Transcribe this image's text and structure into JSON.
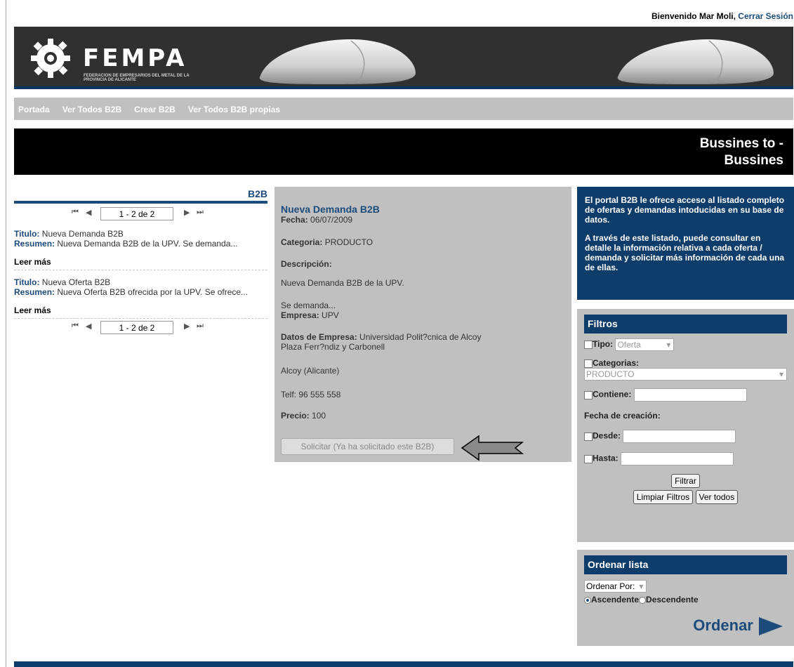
{
  "header": {
    "welcome": "Bienvenido Mar Moli,",
    "logout": "Cerrar Sesión"
  },
  "logo": {
    "name": "FEMPA",
    "subtitle": "FEDERACION DE EMPRESARIOS DEL METAL DE LA PROVINCIA DE ALICANTE"
  },
  "nav": {
    "items": [
      "Portada",
      "Ver Todos B2B",
      "Crear B2B",
      "Ver Todos B2B propias"
    ]
  },
  "page_title": {
    "line1": "Bussines to -",
    "line2": "Bussines"
  },
  "list": {
    "heading": "B2B",
    "pager_text": "1 - 2 de 2",
    "title_label": "Titulo:",
    "summary_label": "Resumen:",
    "items": [
      {
        "title": "Nueva Demanda B2B",
        "summary": "Nueva Demanda B2B de la UPV. Se demanda...",
        "more": "Leer más"
      },
      {
        "title": "Nueva Oferta B2B",
        "summary": "Nueva Oferta B2B ofrecida por la UPV. Se ofrece...",
        "more": "Leer más"
      }
    ]
  },
  "detail": {
    "title": "Nueva Demanda B2B",
    "fecha_label": "Fecha:",
    "fecha": "06/07/2009",
    "categoria_label": "Categoria:",
    "categoria": "PRODUCTO",
    "descripcion_label": "Descripción:",
    "descripcion1": "Nueva Demanda B2B de la UPV.",
    "descripcion2": "Se demanda...",
    "empresa_label": "Empresa:",
    "empresa": "UPV",
    "datos_label": "Datos de Empresa:",
    "datos1": "Universidad Polit?cnica de Alcoy",
    "datos2": "Plaza Ferr?ndiz y Carbonell",
    "ciudad": "Alcoy (Alicante)",
    "telf": "Telf: 96 555 558",
    "precio_label": "Precio:",
    "precio": "100",
    "solicitar": "Solicitar (Ya ha solicitado este B2B)"
  },
  "info": {
    "p1": "El portal B2B le ofrece acceso al listado completo de ofertas y demandas intoducidas en su base de datos.",
    "p2": "A través de este listado, puede consultar en detalle la información relativa a cada oferta / demanda y solicitar más información de cada una de ellas."
  },
  "filtros": {
    "heading": "Filtros",
    "tipo_label": "Tipo:",
    "tipo_value": "Oferta",
    "categorias_label": "Categorias:",
    "categorias_value": "PRODUCTO",
    "contiene_label": "Contiene:",
    "fecha_label": "Fecha de creación:",
    "desde_label": "Desde:",
    "hasta_label": "Hasta:",
    "filtrar": "Filtrar",
    "limpiar": "Limpiar Filtros",
    "ver_todos": "Ver todos"
  },
  "ordenar": {
    "heading": "Ordenar lista",
    "select_value": "Ordenar Por:",
    "asc": "Ascendente",
    "desc": "Descendente",
    "button": "Ordenar"
  }
}
